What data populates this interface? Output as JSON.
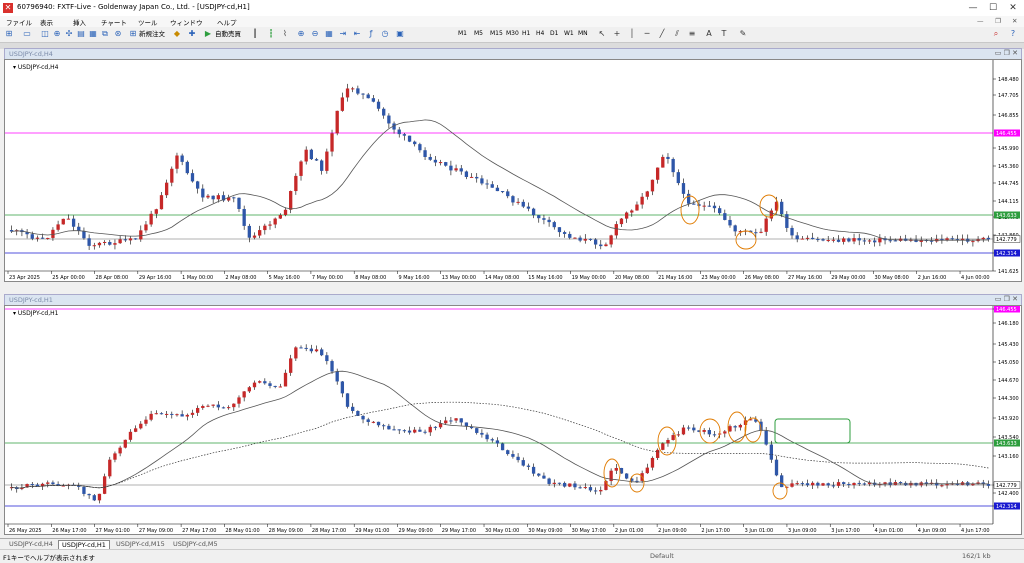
{
  "window": {
    "title": "60796940: FXTF-Live - Goldenway Japan Co., Ltd. - [USDJPY-cd,H1]"
  },
  "menu": [
    "ファイル",
    "表示",
    "挿入",
    "チャート",
    "ツール",
    "ウィンドウ",
    "ヘルプ"
  ],
  "toolbar": {
    "new_order": "新規注文",
    "auto_trading": "自動売買",
    "timeframes": [
      "M1",
      "M5",
      "M15",
      "M30",
      "H1",
      "H4",
      "D1",
      "W1",
      "MN"
    ]
  },
  "colors": {
    "bull": "#c62828",
    "bear": "#2e56a8",
    "ma": "#555555",
    "magenta": "#ff00ff",
    "green": "#2e9e3e",
    "blue": "#1a1ad0",
    "orange": "#e07b00"
  },
  "charts": [
    {
      "label": "USDJPY-cd,H4",
      "header_label": "USDJPY-cd,H4",
      "price_labels": [
        "148.480",
        "147.705",
        "146.855",
        "145.990",
        "145.360",
        "144.745",
        "144.115",
        "143.470",
        "142.860",
        "142.200",
        "141.625"
      ],
      "h_lines": [
        {
          "price": "146.455",
          "color": "magenta"
        },
        {
          "price": "143.633",
          "color": "green"
        },
        {
          "price": "142.779",
          "color": "current"
        },
        {
          "price": "142.314",
          "color": "blue"
        }
      ],
      "time_labels": [
        "23 Apr 2025",
        "25 Apr 00:00",
        "28 Apr 08:00",
        "29 Apr 16:00",
        "1 May 00:00",
        "2 May 08:00",
        "5 May 16:00",
        "7 May 00:00",
        "8 May 08:00",
        "9 May 16:00",
        "13 May 00:00",
        "14 May 08:00",
        "15 May 16:00",
        "19 May 00:00",
        "20 May 08:00",
        "21 May 16:00",
        "23 May 00:00",
        "26 May 08:00",
        "27 May 16:00",
        "29 May 00:00",
        "30 May 08:00",
        "2 Jun 16:00",
        "4 Jun 00:00"
      ]
    },
    {
      "label": "USDJPY-cd,H1",
      "header_label": "USDJPY-cd,H1",
      "price_labels": [
        "146.455",
        "146.180",
        "145.430",
        "145.050",
        "144.670",
        "144.300",
        "143.920",
        "143.540",
        "143.160",
        "142.779",
        "142.400",
        "142.314"
      ],
      "h_lines": [
        {
          "price": "146.455",
          "color": "magenta"
        },
        {
          "price": "143.633",
          "color": "green"
        },
        {
          "price": "142.779",
          "color": "current"
        },
        {
          "price": "142.314",
          "color": "blue"
        }
      ],
      "time_labels": [
        "26 May 2025",
        "26 May 17:00",
        "27 May 01:00",
        "27 May 09:00",
        "27 May 17:00",
        "28 May 01:00",
        "28 May 09:00",
        "28 May 17:00",
        "29 May 01:00",
        "29 May 09:00",
        "29 May 17:00",
        "30 May 01:00",
        "30 May 09:00",
        "30 May 17:00",
        "2 Jun 01:00",
        "2 Jun 09:00",
        "2 Jun 17:00",
        "3 Jun 01:00",
        "3 Jun 09:00",
        "3 Jun 17:00",
        "4 Jun 01:00",
        "4 Jun 09:00",
        "4 Jun 17:00"
      ]
    }
  ],
  "tabs": [
    "USDJPY-cd,H4",
    "USDJPY-cd,H1",
    "USDJPY-cd,M15",
    "USDJPY-cd,M5"
  ],
  "status": {
    "help": "F1キーでヘルプが表示されます",
    "mid": "Default",
    "right": "162/1 kb"
  }
}
